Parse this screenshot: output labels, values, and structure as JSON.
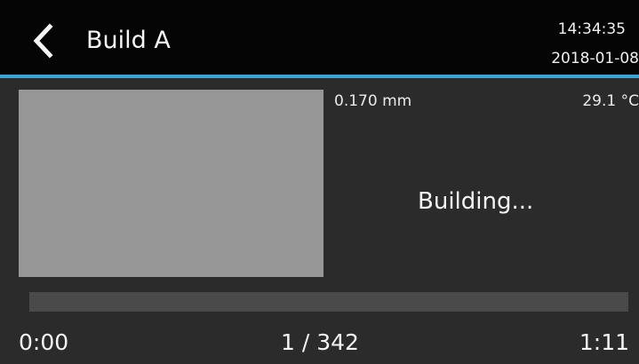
{
  "header": {
    "back_icon": "chevron-left-icon",
    "title": "Build A",
    "time": "14:34:35",
    "date": "2018-01-08"
  },
  "colors": {
    "accent": "#3aa6d8",
    "header_bg": "#050505",
    "body_bg": "#2b2b2b",
    "preview_bg": "#979797",
    "progress_track": "#4a4a4a"
  },
  "build": {
    "layer_height": "0.170 mm",
    "temperature": "29.1 °C",
    "status": "Building...",
    "progress_fraction": 0,
    "elapsed": "0:00",
    "layer_count": "1 / 342",
    "remaining": "1:11"
  }
}
